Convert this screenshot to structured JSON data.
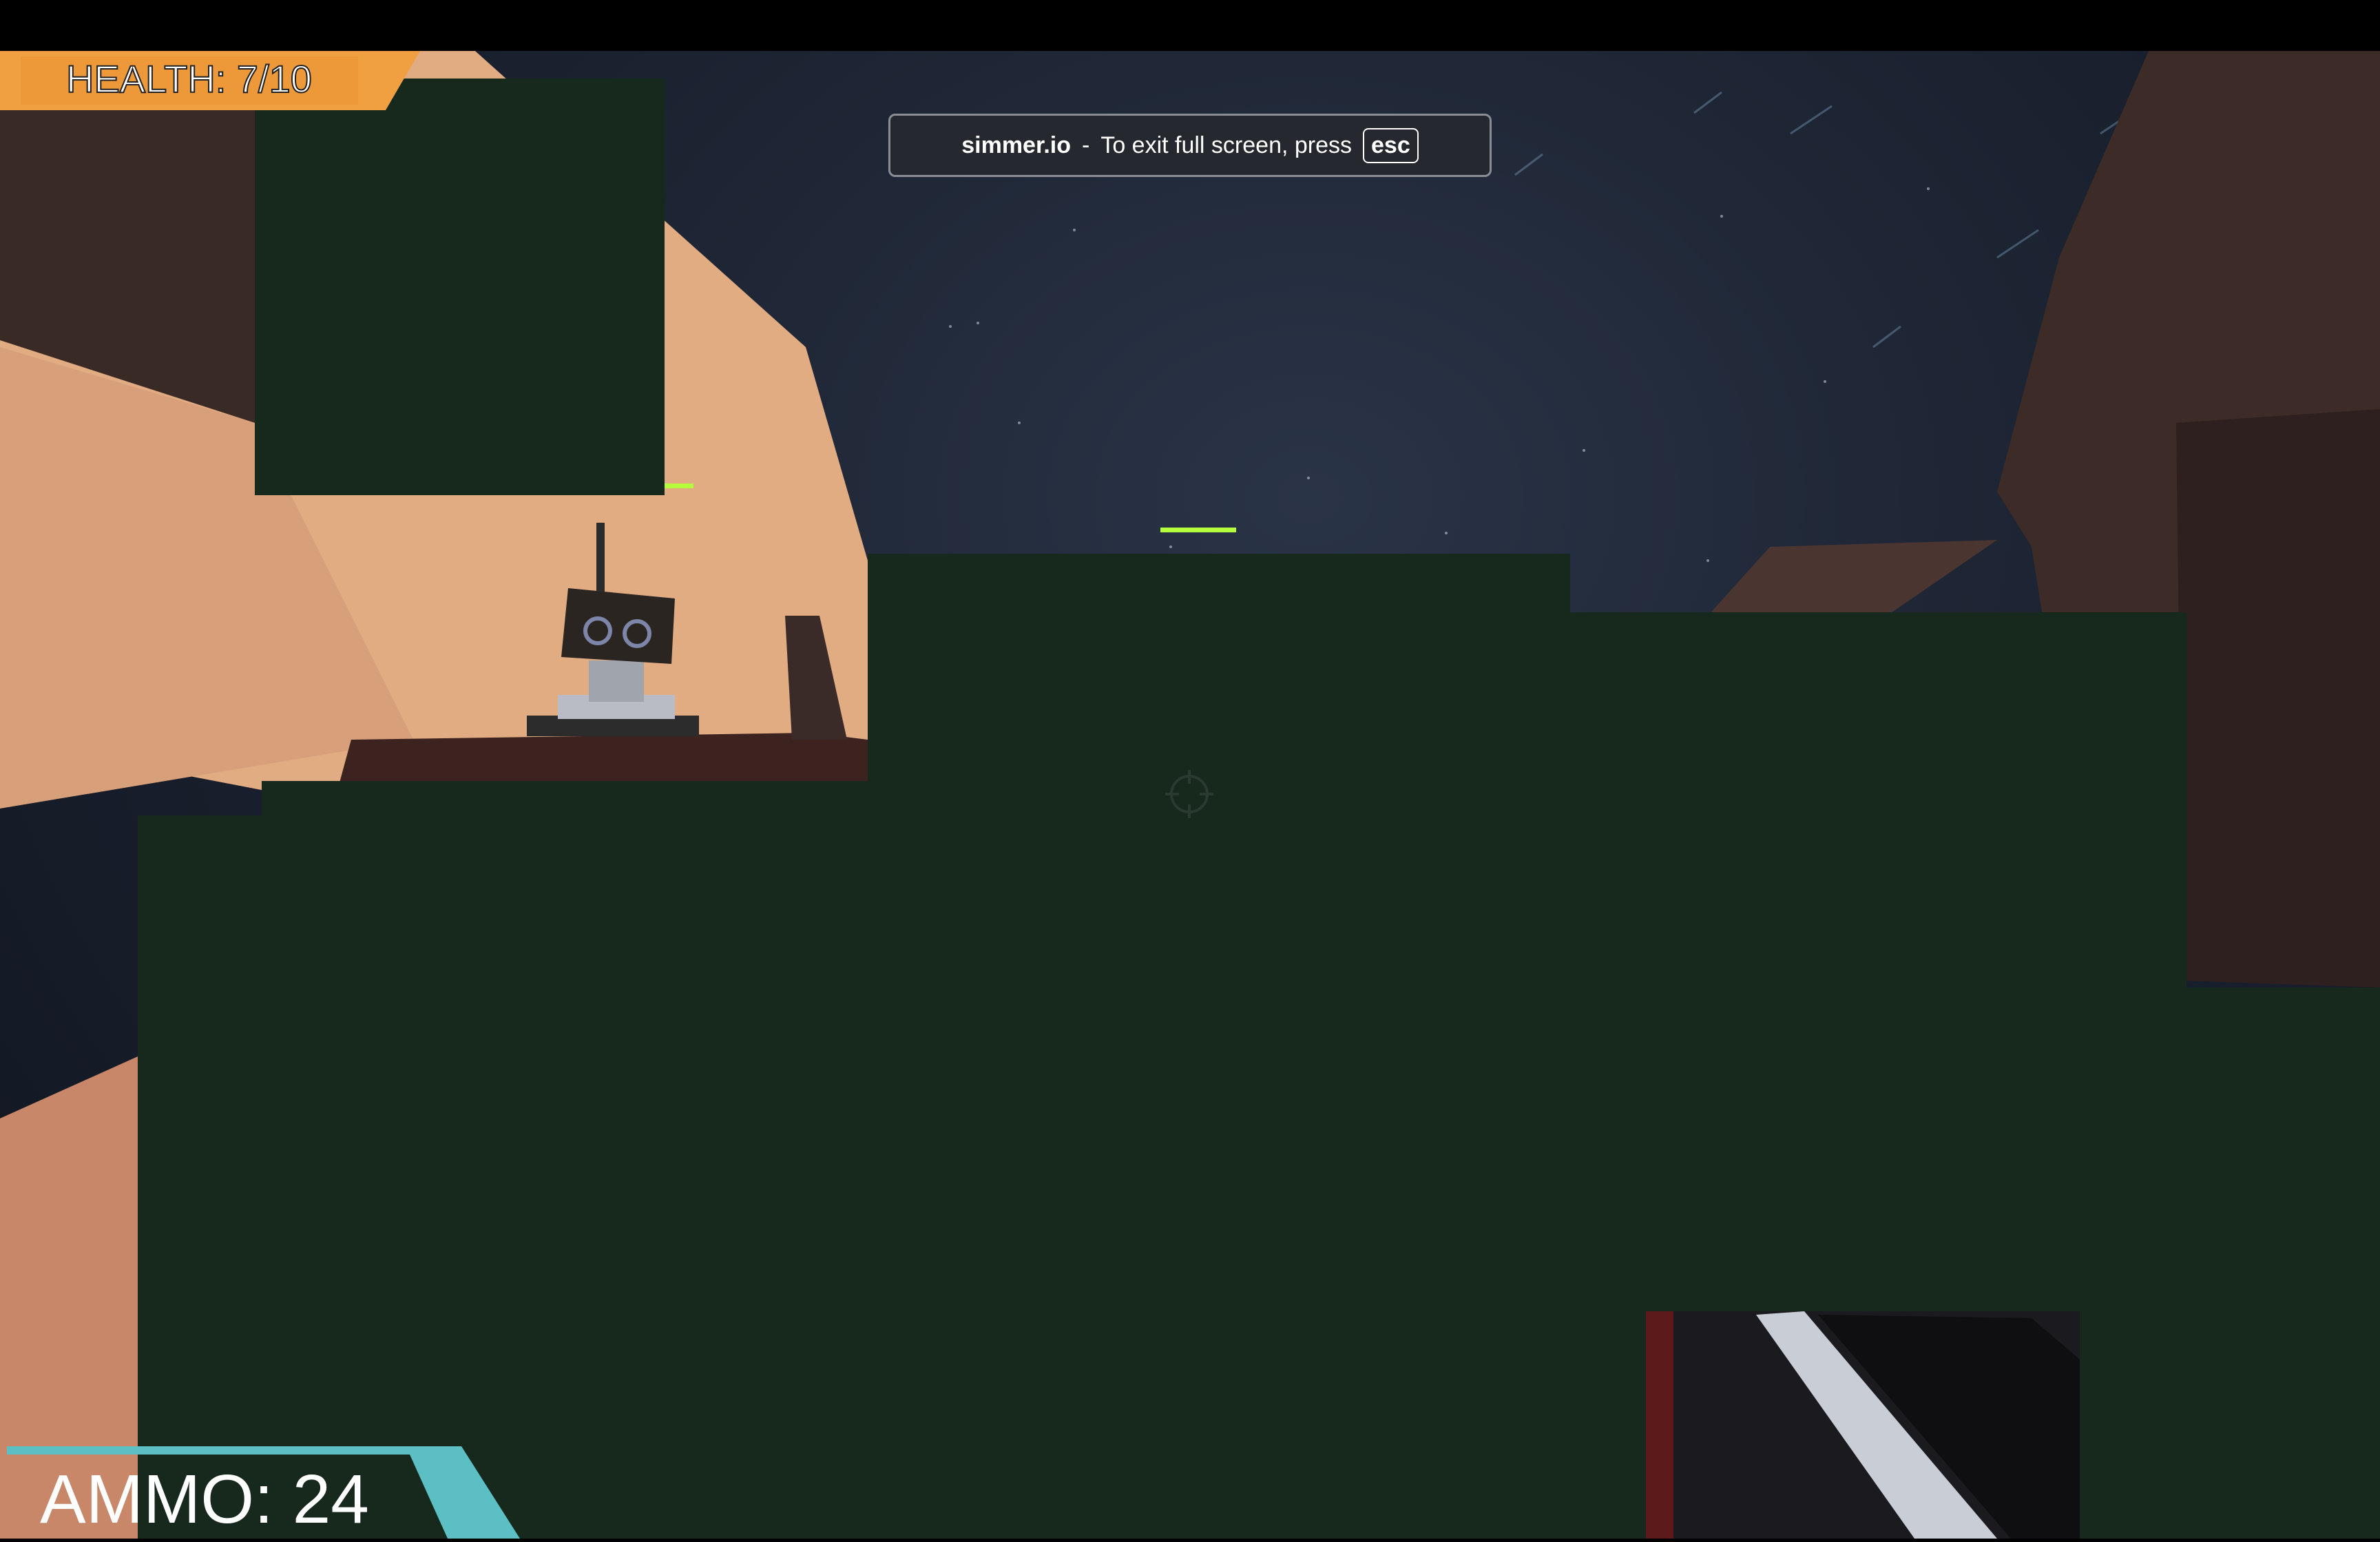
{
  "hud": {
    "health_label": "HEALTH: 7/10",
    "health_current": 7,
    "health_max": 10,
    "ammo_label": "AMMO: 24",
    "ammo_count": 24
  },
  "fullscreen_notice": {
    "site": "simmer.io",
    "separator": "-",
    "message": "To exit full screen, press",
    "key": "esc"
  },
  "colors": {
    "health_accent": "#f0a040",
    "ammo_accent": "#5bbfc4",
    "foliage": "#16291c",
    "sand": "#e2ac83",
    "rock": "#4a3530",
    "sky": "#1b2230",
    "tracer": "#b6ff3d"
  },
  "icons": [
    "crosshair-icon",
    "robot-turret-icon",
    "gun-weapon-icon"
  ]
}
